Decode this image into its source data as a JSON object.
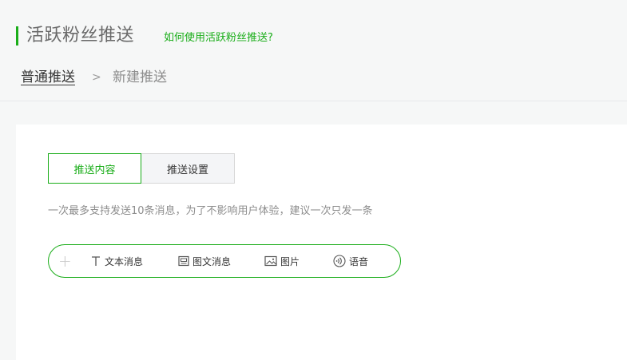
{
  "header": {
    "title": "活跃粉丝推送",
    "help_link": "如何使用活跃粉丝推送?"
  },
  "breadcrumb": {
    "home": "普通推送",
    "separator": ">",
    "current": "新建推送"
  },
  "tabs": [
    {
      "label": "推送内容",
      "active": true
    },
    {
      "label": "推送设置",
      "active": false
    }
  ],
  "hint": "一次最多支持发送10条消息，为了不影响用户体验，建议一次只发一条",
  "toolbar": {
    "add_symbol": "+",
    "items": [
      {
        "label": "文本消息",
        "icon": "text-icon"
      },
      {
        "label": "图文消息",
        "icon": "article-icon"
      },
      {
        "label": "图片",
        "icon": "image-icon"
      },
      {
        "label": "语音",
        "icon": "voice-icon"
      }
    ]
  },
  "colors": {
    "accent": "#1aad19",
    "background": "#f6f7f7",
    "panel": "#ffffff"
  }
}
